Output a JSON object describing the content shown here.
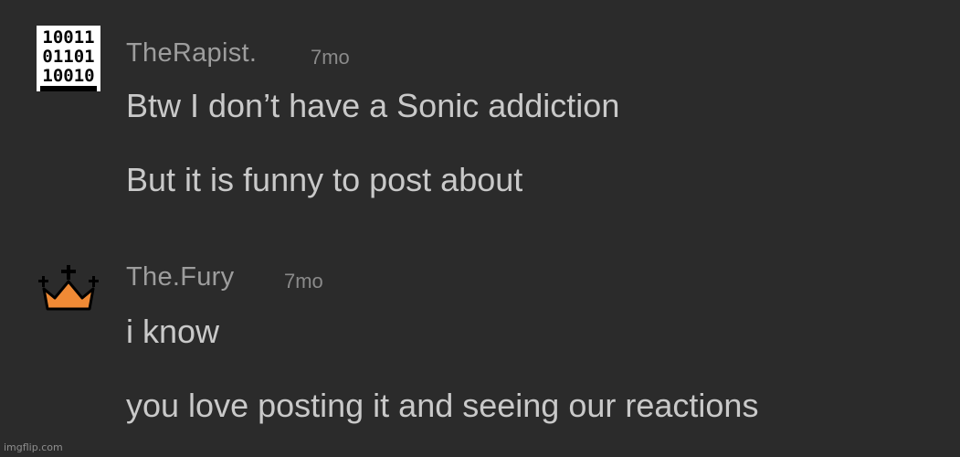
{
  "comments": [
    {
      "username": "TheRapist.",
      "timestamp": "7mo",
      "avatar_icon": "binary-code-icon",
      "avatar_binary": [
        "10011",
        "01101",
        "10010"
      ],
      "lines": [
        "Btw I don’t have a Sonic addiction",
        "But it is funny to post about"
      ]
    },
    {
      "username": "The.Fury",
      "timestamp": "7mo",
      "avatar_icon": "crown-icon",
      "avatar_color": "#f08a35",
      "lines": [
        "i know",
        "you love posting it and seeing our reactions"
      ]
    }
  ],
  "watermark": "imgflip.com",
  "colors": {
    "background": "#2b2b2b",
    "username": "#9d9d9d",
    "timestamp": "#8a8a8a",
    "text": "#c9c9c9"
  }
}
